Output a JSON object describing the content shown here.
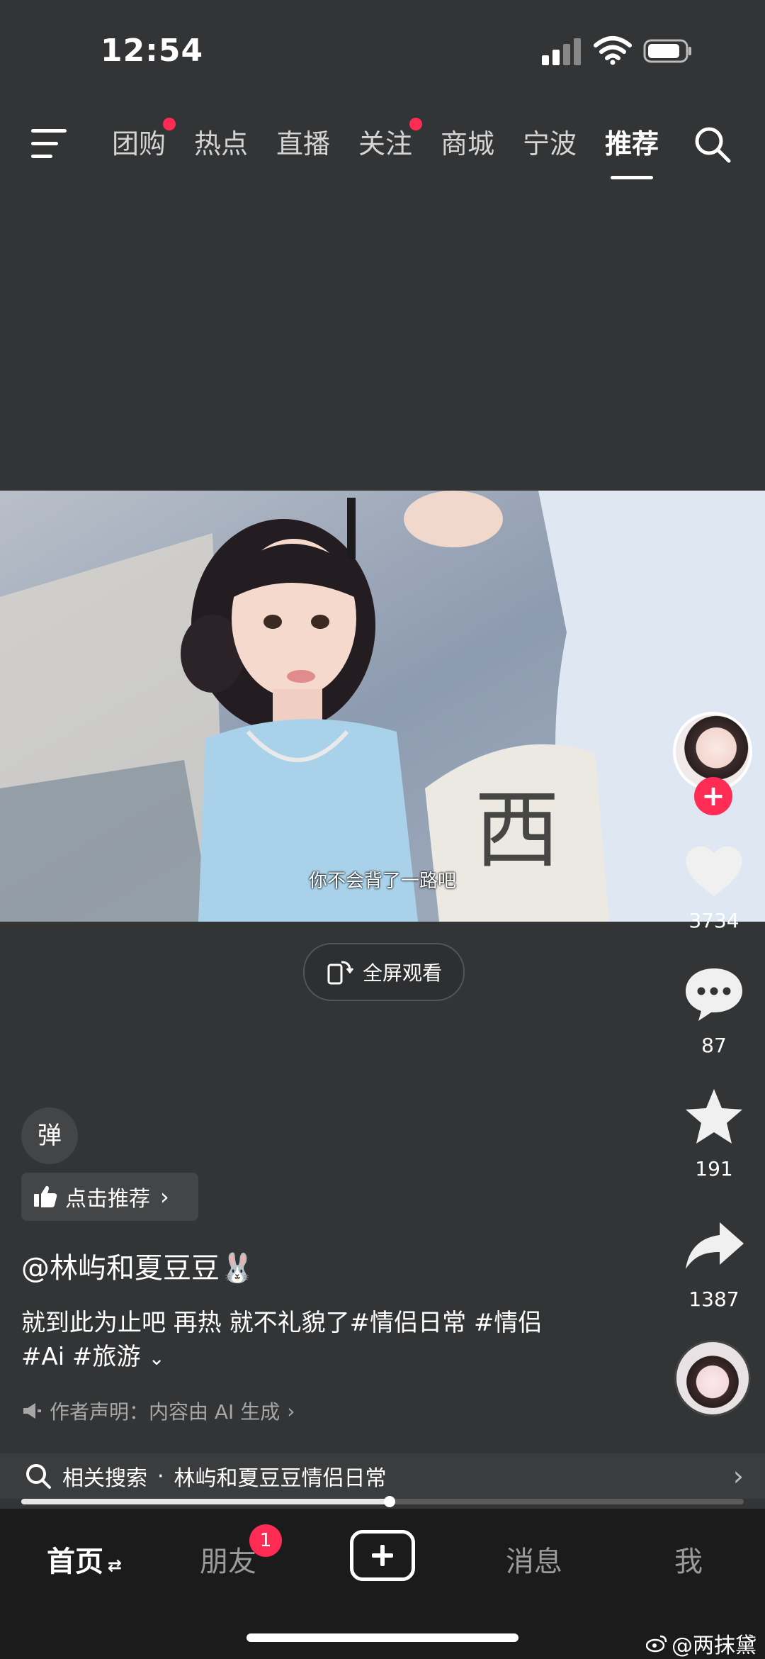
{
  "status_bar": {
    "time": "12:54"
  },
  "top_tabs": [
    {
      "label": "团购",
      "dot": true
    },
    {
      "label": "热点",
      "dot": false
    },
    {
      "label": "直播",
      "dot": false
    },
    {
      "label": "关注",
      "dot": true
    },
    {
      "label": "商城",
      "dot": false
    },
    {
      "label": "宁波",
      "dot": false
    },
    {
      "label": "推荐",
      "dot": false,
      "active": true
    }
  ],
  "video": {
    "subtitle": "你不会背了一路吧",
    "fullscreen_label": "全屏观看"
  },
  "actions": {
    "likes": "3734",
    "comments": "87",
    "favorites": "191",
    "shares": "1387"
  },
  "info": {
    "danmu_label": "弹",
    "recommend_label": "点击推荐",
    "username": "@林屿和夏豆豆🐰",
    "description_line1": "就到此为止吧  再热  就不礼貌了#情侣日常 #情侣",
    "description_line2": "#Ai #旅游",
    "declaration": "作者声明：内容由 AI 生成"
  },
  "related_search": {
    "label": "相关搜索",
    "separator": "·",
    "query": "林屿和夏豆豆情侣日常"
  },
  "progress": {
    "fraction": 0.51
  },
  "bottom_nav": {
    "home": "首页",
    "friends": "朋友",
    "friends_badge": "1",
    "messages": "消息",
    "me": "我"
  },
  "watermark": "@两抹黛",
  "colors": {
    "accent": "#fe2c55",
    "background": "#333435"
  }
}
